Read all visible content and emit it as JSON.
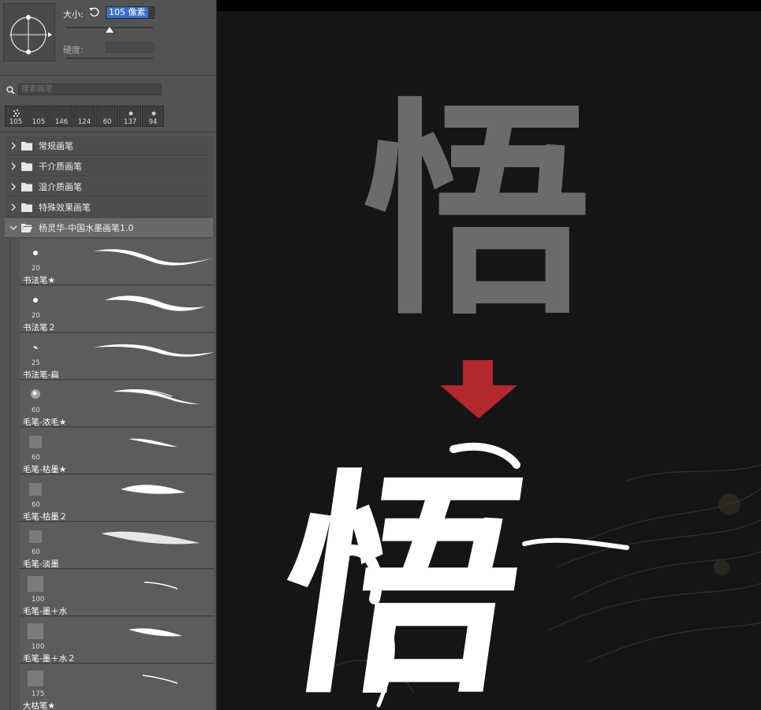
{
  "brush_panel": {
    "size_label": "大小:",
    "size_value": "105 像素",
    "hardness_label": "硬度:",
    "search_placeholder": "搜索画笔",
    "recent_brushes": [
      "105",
      "105",
      "146",
      "124",
      "60",
      "137",
      "94"
    ],
    "folders": [
      {
        "label": "常规画笔",
        "expanded": false
      },
      {
        "label": "干介质画笔",
        "expanded": false
      },
      {
        "label": "湿介质画笔",
        "expanded": false
      },
      {
        "label": "特殊效果画笔",
        "expanded": false
      },
      {
        "label": "杨灵华-中国水墨画笔1.0",
        "expanded": true
      }
    ],
    "brushes": [
      {
        "size": "20",
        "name": "书法笔★"
      },
      {
        "size": "20",
        "name": "书法笔２"
      },
      {
        "size": "25",
        "name": "书法笔-扁"
      },
      {
        "size": "60",
        "name": "毛笔-浓毛★"
      },
      {
        "size": "60",
        "name": "毛笔-枯墨★"
      },
      {
        "size": "60",
        "name": "毛笔-枯墨２"
      },
      {
        "size": "60",
        "name": "毛笔-淡墨"
      },
      {
        "size": "100",
        "name": "毛笔-墨＋水"
      },
      {
        "size": "100",
        "name": "毛笔-墨＋水２"
      },
      {
        "size": "175",
        "name": "大枯笔★"
      }
    ]
  },
  "canvas": {
    "glyph_before": "悟",
    "glyph_after": "悟",
    "arrow_color": "#b3282d",
    "glyph_before_color": "#6b6b6b",
    "glyph_after_color": "#ffffff"
  },
  "icons": {
    "reset": "reset-icon",
    "search": "search-icon",
    "folder": "folder-icon",
    "chevron": "chevron-right-icon",
    "arrow": "arrow-down-icon"
  }
}
